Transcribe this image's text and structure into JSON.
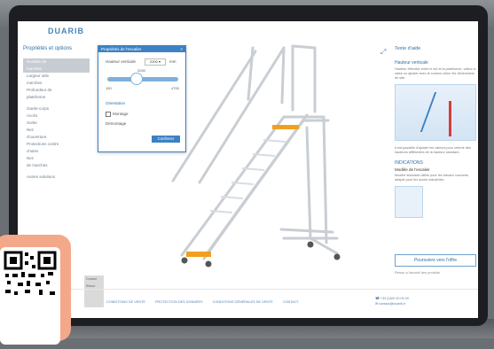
{
  "brand": {
    "logo_text": "DUARIB"
  },
  "left_panel": {
    "title": "Propriétés et options",
    "items": [
      {
        "label": "Nombre de",
        "active": true
      },
      {
        "label": "marches",
        "active": true
      },
      {
        "label": "Largeur utile",
        "active": false
      },
      {
        "label": "marches",
        "active": false
      },
      {
        "label": "Profondeur de",
        "active": false
      },
      {
        "label": "plateforme",
        "active": false
      }
    ],
    "groups": [
      [
        "Garde-corps",
        "Accès",
        "Sortie",
        "Nez",
        "d'ouverture",
        "Protections contre",
        "chutes",
        "Nez",
        "de marches"
      ],
      [
        "Autres solutions"
      ]
    ]
  },
  "dialog": {
    "title": "Propriétés de l'escalier",
    "height_label": "Hauteur verticale",
    "height_value": "2200",
    "unit": "mm",
    "slider_value": "2200",
    "slider_min": "100",
    "slider_max": "4700",
    "section_label": "Orientation",
    "option1": "Montage",
    "option2": "Démontage",
    "apply_button": "Confirmer"
  },
  "right_panel": {
    "title": "Texte d'aide",
    "subtitle": "Hauteur verticale",
    "text1": "Hauteur effective entre le sol et la plateforme, valeur à saisir ou ajuster avec le curseur selon les dimensions du site.",
    "text2": "Il est possible d'ajuster les valeurs pour obtenir des hauteurs différentes de la hauteur standard.",
    "section2_title": "INDICATIONS",
    "section2_sub": "Modèle de l'escalier",
    "text3": "Modèle standard utilisé pour les travaux courants, adapté pour les accès industriels.",
    "cta_button": "Poursuivre vers l'offre",
    "cta_note": "Retour à l'accueil des produits"
  },
  "footer": {
    "links": [
      "CONDITIONS DE VENTE",
      "PROTECTION DES DONNÉES",
      "CONDITIONS GÉNÉRALES DE VENTE",
      "CONTACT"
    ],
    "right_lines": [
      "+33 (0)00 00 00 00",
      "contact@duarib.fr"
    ]
  },
  "side_panel": {
    "line1": "Contact",
    "line2": "Retour"
  },
  "colors": {
    "accent": "#3b82c4",
    "ladder_steel": "#c8ced4",
    "tread_orange": "#f0a020",
    "qr_frame": "#f4a88a"
  }
}
